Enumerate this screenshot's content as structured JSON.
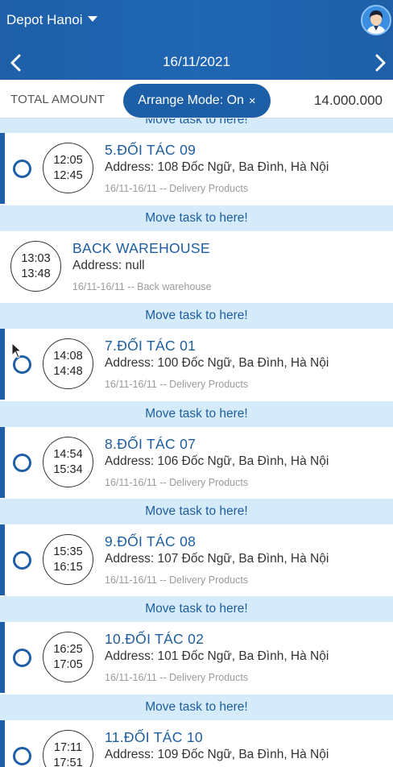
{
  "header": {
    "depot_label": "Depot Hanoi",
    "date": "16/11/2021"
  },
  "summary": {
    "total_label": "TOTAL AMOUNT",
    "total_value": "14.000.000",
    "arrange_mode_label": "Arrange Mode: On",
    "arrange_close_icon": "×"
  },
  "drop_label": "Move task to here!",
  "tasks": [
    {
      "title": "5.ĐỐI TÁC 09",
      "start": "12:05",
      "end": "12:45",
      "address": "Address: 108 Đốc Ngữ, Ba Đình, Hà Nội",
      "meta": "16/11-16/11 -- Delivery Products"
    },
    {
      "title": "BACK WAREHOUSE",
      "start": "13:03",
      "end": "13:48",
      "address": "Address: null",
      "meta": "16/11-16/11 -- Back warehouse"
    },
    {
      "title": "7.ĐỐI TÁC 01",
      "start": "14:08",
      "end": "14:48",
      "address": "Address: 100 Đốc Ngữ, Ba Đình, Hà Nội",
      "meta": "16/11-16/11 -- Delivery Products"
    },
    {
      "title": "8.ĐỐI TÁC 07",
      "start": "14:54",
      "end": "15:34",
      "address": "Address: 106 Đốc Ngữ, Ba Đình, Hà Nội",
      "meta": "16/11-16/11 -- Delivery Products"
    },
    {
      "title": "9.ĐỐI TÁC 08",
      "start": "15:35",
      "end": "16:15",
      "address": "Address: 107 Đốc Ngữ, Ba Đình, Hà Nội",
      "meta": "16/11-16/11 -- Delivery Products"
    },
    {
      "title": "10.ĐỐI TÁC 02",
      "start": "16:25",
      "end": "17:05",
      "address": "Address: 101 Đốc Ngữ, Ba Đình, Hà Nội",
      "meta": "16/11-16/11 -- Delivery Products"
    },
    {
      "title": "11.ĐỐI TÁC 10",
      "start": "17:11",
      "end": "17:51",
      "address": "Address: 109 Đốc Ngữ, Ba Đình, Hà Nội",
      "meta": ""
    }
  ],
  "icons": {
    "depot_dropdown": "caret-down-icon",
    "prev": "chevron-left-icon",
    "next": "chevron-right-icon",
    "avatar": "user-avatar-icon",
    "cursor": "mouse-pointer-icon"
  },
  "colors": {
    "primary": "#1e5fa8",
    "drop_zone": "#d6ebf9",
    "link_text": "#1d5d9e"
  }
}
